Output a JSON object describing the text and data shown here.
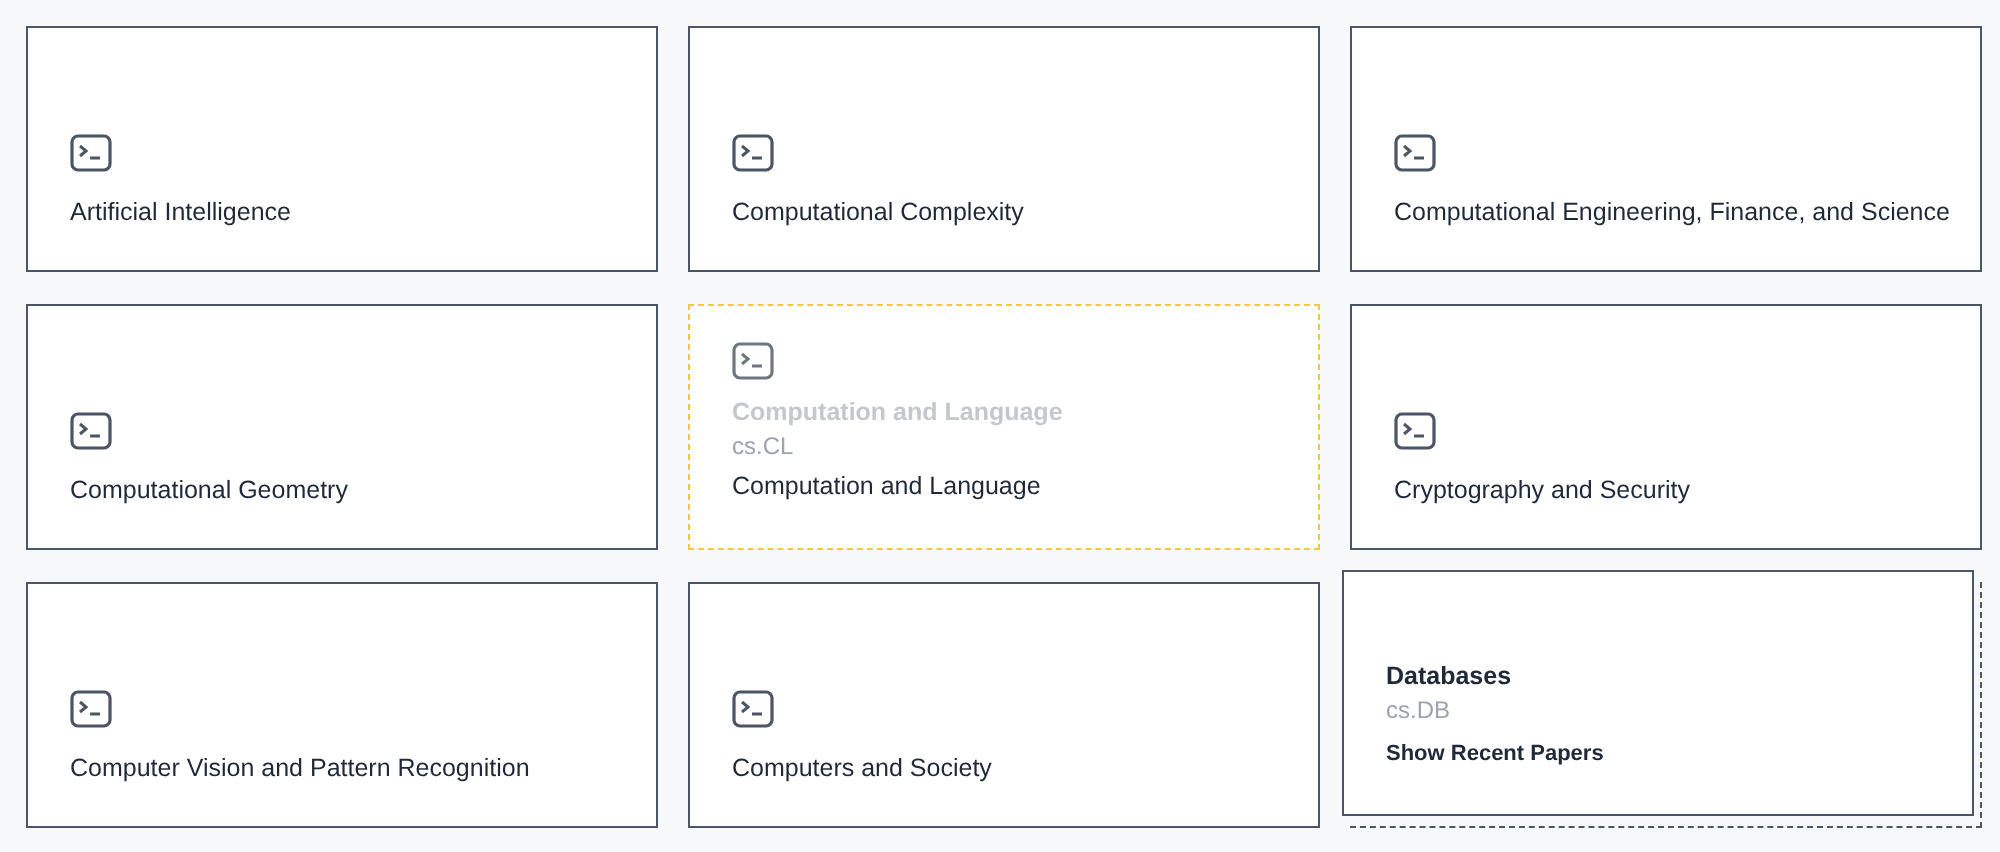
{
  "cards": [
    {
      "kind": "default",
      "title": "Artificial Intelligence"
    },
    {
      "kind": "default",
      "title": "Computational Complexity"
    },
    {
      "kind": "default",
      "title": "Computational Engineering, Finance, and Science"
    },
    {
      "kind": "default",
      "title": "Computational Geometry"
    },
    {
      "kind": "dragging",
      "title": "Computation and Language",
      "ghost_title": "Computation and Language",
      "code": "cs.CL"
    },
    {
      "kind": "default",
      "title": "Cryptography and Security"
    },
    {
      "kind": "default",
      "title": "Computer Vision and Pattern Recognition"
    },
    {
      "kind": "default",
      "title": "Computers and Society"
    },
    {
      "kind": "hover",
      "title": "Databases",
      "code": "cs.DB",
      "action": "Show Recent Papers"
    }
  ]
}
